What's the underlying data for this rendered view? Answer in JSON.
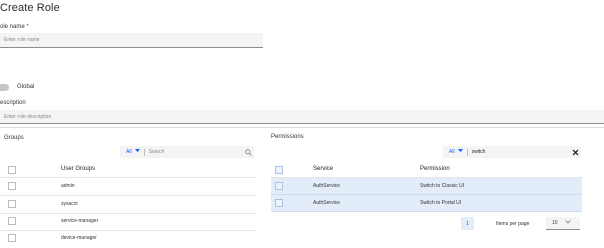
{
  "page": {
    "title": "Create Role"
  },
  "role_name": {
    "label": "ole name",
    "required_mark": "*",
    "placeholder": "Enter role name"
  },
  "global_toggle": {
    "label": "Global"
  },
  "description": {
    "label": "escription",
    "placeholder": "Enter role description"
  },
  "groups": {
    "title": "Groups",
    "filter_label": "All",
    "search_placeholder": "Search",
    "column_header": "User Groups",
    "rows": [
      "admin",
      "sysacct",
      "service-manager",
      "device-manager"
    ]
  },
  "permissions": {
    "title": "Permissions",
    "filter_label": "All",
    "search_value": "switch",
    "columns": {
      "service": "Service",
      "permission": "Permission"
    },
    "rows": [
      {
        "service": "AuthService",
        "permission": "Switch to Classic UI"
      },
      {
        "service": "AuthService",
        "permission": "Switch to Portal UI"
      }
    ],
    "pagination": {
      "page": "1",
      "items_per_page_label": "Items per page",
      "items_per_page": "10"
    }
  },
  "colors": {
    "accent": "#0f62fe",
    "selected_row": "#e3edfa",
    "field_bg": "#f4f4f4"
  },
  "icons": {
    "filter_chevron": "chevron-down-icon",
    "search": "search-icon",
    "clear": "close-icon",
    "select_chevron": "chevron-down-icon"
  }
}
